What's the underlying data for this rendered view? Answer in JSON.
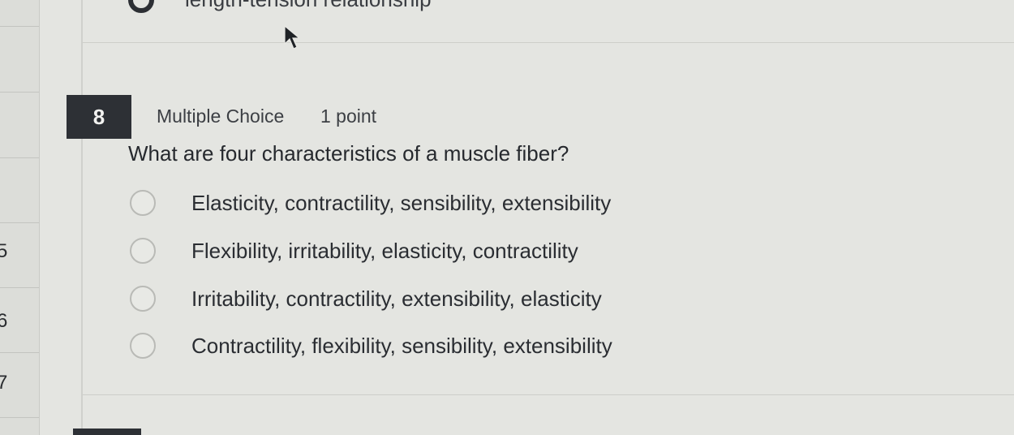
{
  "nav": {
    "numbers": [
      "",
      "",
      "5",
      "6",
      "7"
    ]
  },
  "previous_question": {
    "option_label": "length-tension relationship"
  },
  "question": {
    "number": "8",
    "type": "Multiple Choice",
    "points": "1 point",
    "prompt": "What are four characteristics of a muscle fiber?",
    "options": [
      {
        "label": "Elasticity, contractility, sensibility, extensibility",
        "selected": false
      },
      {
        "label": "Flexibility, irritability, elasticity, contractility",
        "selected": false
      },
      {
        "label": "Irritability, contractility, extensibility, elasticity",
        "selected": false
      },
      {
        "label": "Contractility, flexibility, sensibility, extensibility",
        "selected": false
      }
    ]
  },
  "icons": {
    "cursor": "mouse-pointer-icon",
    "radio": "radio-button-icon"
  }
}
